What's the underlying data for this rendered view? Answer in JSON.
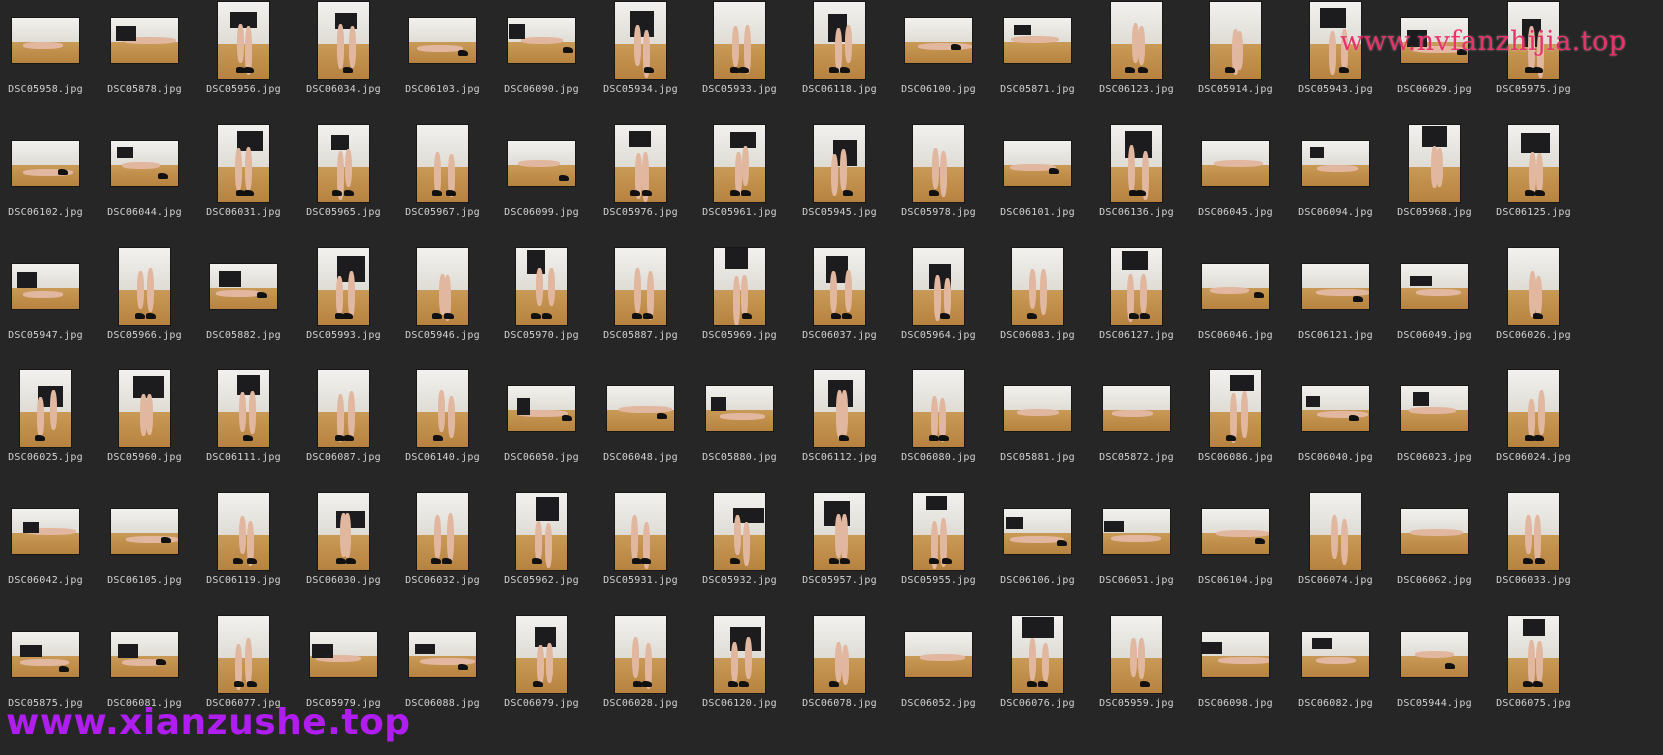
{
  "watermarks": {
    "top": "www.nvfanzhijia.top",
    "bottom": "www.xianzushe.top"
  },
  "colors": {
    "background": "#262626",
    "label_text": "#d2d2d2",
    "watermark_top": "#e8336a",
    "watermark_bottom": "#b01df0"
  },
  "rows": [
    [
      {
        "name": "DSC05958.jpg",
        "o": "l"
      },
      {
        "name": "DSC05878.jpg",
        "o": "l"
      },
      {
        "name": "DSC05956.jpg",
        "o": "p"
      },
      {
        "name": "DSC06034.jpg",
        "o": "p"
      },
      {
        "name": "DSC06103.jpg",
        "o": "l"
      },
      {
        "name": "DSC06090.jpg",
        "o": "l"
      },
      {
        "name": "DSC05934.jpg",
        "o": "p"
      },
      {
        "name": "DSC05933.jpg",
        "o": "p"
      },
      {
        "name": "DSC06118.jpg",
        "o": "p"
      },
      {
        "name": "DSC06100.jpg",
        "o": "l"
      },
      {
        "name": "DSC05871.jpg",
        "o": "l"
      },
      {
        "name": "DSC06123.jpg",
        "o": "p"
      },
      {
        "name": "DSC05914.jpg",
        "o": "p"
      },
      {
        "name": "DSC05943.jpg",
        "o": "p"
      },
      {
        "name": "DSC06029.jpg",
        "o": "l"
      },
      {
        "name": "DSC05975.jpg",
        "o": "p"
      }
    ],
    [
      {
        "name": "DSC06102.jpg",
        "o": "l"
      },
      {
        "name": "DSC06044.jpg",
        "o": "l"
      },
      {
        "name": "DSC06031.jpg",
        "o": "p"
      },
      {
        "name": "DSC05965.jpg",
        "o": "p"
      },
      {
        "name": "DSC05967.jpg",
        "o": "p"
      },
      {
        "name": "DSC06099.jpg",
        "o": "l"
      },
      {
        "name": "DSC05976.jpg",
        "o": "p"
      },
      {
        "name": "DSC05961.jpg",
        "o": "p"
      },
      {
        "name": "DSC05945.jpg",
        "o": "p"
      },
      {
        "name": "DSC05978.jpg",
        "o": "p"
      },
      {
        "name": "DSC06101.jpg",
        "o": "l"
      },
      {
        "name": "DSC06136.jpg",
        "o": "p"
      },
      {
        "name": "DSC06045.jpg",
        "o": "l"
      },
      {
        "name": "DSC06094.jpg",
        "o": "l"
      },
      {
        "name": "DSC05968.jpg",
        "o": "p"
      },
      {
        "name": "DSC06125.jpg",
        "o": "p"
      }
    ],
    [
      {
        "name": "DSC05947.jpg",
        "o": "l"
      },
      {
        "name": "DSC05966.jpg",
        "o": "p"
      },
      {
        "name": "DSC05882.jpg",
        "o": "l"
      },
      {
        "name": "DSC05993.jpg",
        "o": "p"
      },
      {
        "name": "DSC05946.jpg",
        "o": "p"
      },
      {
        "name": "DSC05970.jpg",
        "o": "p"
      },
      {
        "name": "DSC05887.jpg",
        "o": "p"
      },
      {
        "name": "DSC05969.jpg",
        "o": "p"
      },
      {
        "name": "DSC06037.jpg",
        "o": "p"
      },
      {
        "name": "DSC05964.jpg",
        "o": "p"
      },
      {
        "name": "DSC06083.jpg",
        "o": "p"
      },
      {
        "name": "DSC06127.jpg",
        "o": "p"
      },
      {
        "name": "DSC06046.jpg",
        "o": "l"
      },
      {
        "name": "DSC06121.jpg",
        "o": "l"
      },
      {
        "name": "DSC06049.jpg",
        "o": "l"
      },
      {
        "name": "DSC06026.jpg",
        "o": "p"
      }
    ],
    [
      {
        "name": "DSC06025.jpg",
        "o": "p"
      },
      {
        "name": "DSC05960.jpg",
        "o": "p"
      },
      {
        "name": "DSC06111.jpg",
        "o": "p"
      },
      {
        "name": "DSC06087.jpg",
        "o": "p"
      },
      {
        "name": "DSC06140.jpg",
        "o": "p"
      },
      {
        "name": "DSC06050.jpg",
        "o": "l"
      },
      {
        "name": "DSC06048.jpg",
        "o": "l"
      },
      {
        "name": "DSC05880.jpg",
        "o": "l"
      },
      {
        "name": "DSC06112.jpg",
        "o": "p"
      },
      {
        "name": "DSC06080.jpg",
        "o": "p"
      },
      {
        "name": "DSC05881.jpg",
        "o": "l"
      },
      {
        "name": "DSC05872.jpg",
        "o": "l"
      },
      {
        "name": "DSC06086.jpg",
        "o": "p"
      },
      {
        "name": "DSC06040.jpg",
        "o": "l"
      },
      {
        "name": "DSC06023.jpg",
        "o": "l"
      },
      {
        "name": "DSC06024.jpg",
        "o": "p"
      }
    ],
    [
      {
        "name": "DSC06042.jpg",
        "o": "l"
      },
      {
        "name": "DSC06105.jpg",
        "o": "l"
      },
      {
        "name": "DSC06119.jpg",
        "o": "p"
      },
      {
        "name": "DSC06030.jpg",
        "o": "p"
      },
      {
        "name": "DSC06032.jpg",
        "o": "p"
      },
      {
        "name": "DSC05962.jpg",
        "o": "p"
      },
      {
        "name": "DSC05931.jpg",
        "o": "p"
      },
      {
        "name": "DSC05932.jpg",
        "o": "p"
      },
      {
        "name": "DSC05957.jpg",
        "o": "p"
      },
      {
        "name": "DSC05955.jpg",
        "o": "p"
      },
      {
        "name": "DSC06106.jpg",
        "o": "l"
      },
      {
        "name": "DSC06051.jpg",
        "o": "l"
      },
      {
        "name": "DSC06104.jpg",
        "o": "l"
      },
      {
        "name": "DSC06074.jpg",
        "o": "p"
      },
      {
        "name": "DSC06062.jpg",
        "o": "l"
      },
      {
        "name": "DSC06033.jpg",
        "o": "p"
      }
    ],
    [
      {
        "name": "DSC05875.jpg",
        "o": "l"
      },
      {
        "name": "DSC06081.jpg",
        "o": "l"
      },
      {
        "name": "DSC06077.jpg",
        "o": "p"
      },
      {
        "name": "DSC05979.jpg",
        "o": "l"
      },
      {
        "name": "DSC06088.jpg",
        "o": "l"
      },
      {
        "name": "DSC06079.jpg",
        "o": "p"
      },
      {
        "name": "DSC06028.jpg",
        "o": "p"
      },
      {
        "name": "DSC06120.jpg",
        "o": "p"
      },
      {
        "name": "DSC06078.jpg",
        "o": "p"
      },
      {
        "name": "DSC06052.jpg",
        "o": "l"
      },
      {
        "name": "DSC06076.jpg",
        "o": "p"
      },
      {
        "name": "DSC05959.jpg",
        "o": "p"
      },
      {
        "name": "DSC06098.jpg",
        "o": "l"
      },
      {
        "name": "DSC06082.jpg",
        "o": "l"
      },
      {
        "name": "DSC05944.jpg",
        "o": "l"
      },
      {
        "name": "DSC06075.jpg",
        "o": "p"
      }
    ]
  ]
}
